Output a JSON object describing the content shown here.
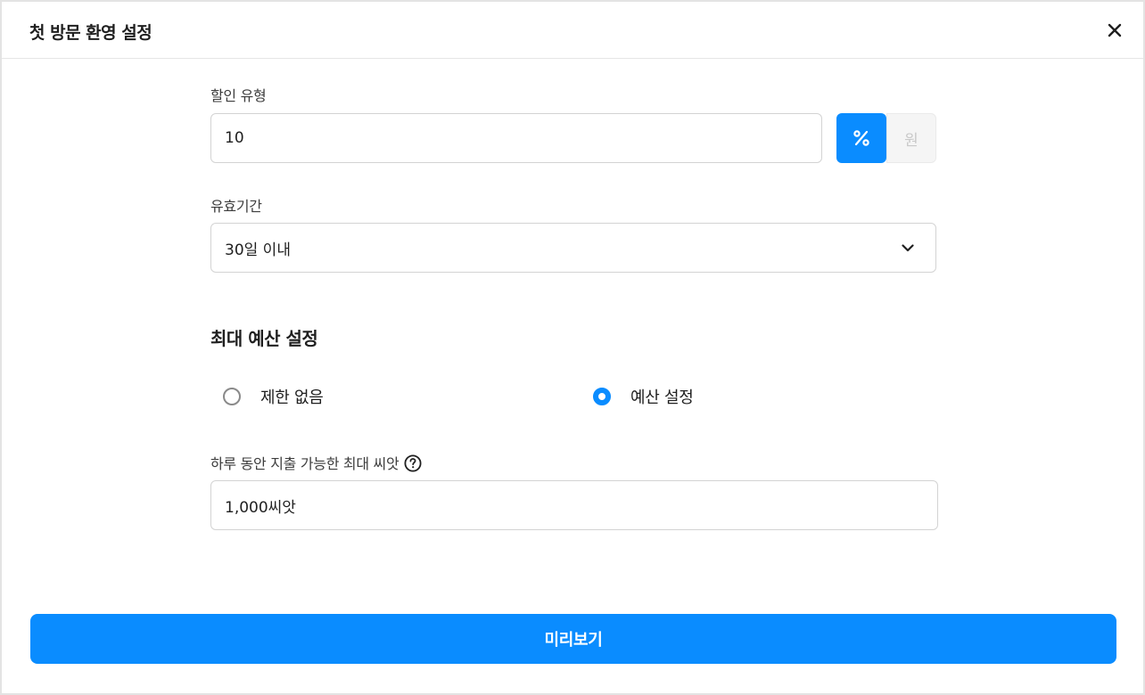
{
  "header": {
    "title": "첫 방문 환영 설정"
  },
  "discount": {
    "label": "할인 유형",
    "value": "10",
    "units": [
      "%",
      "원"
    ],
    "selected_unit": "%"
  },
  "validity": {
    "label": "유효기간",
    "selected": "30일 이내"
  },
  "budget": {
    "title": "최대 예산 설정",
    "options": [
      {
        "label": "제한 없음",
        "selected": false
      },
      {
        "label": "예산 설정",
        "selected": true
      }
    ],
    "daily_label": "하루 동안 지출 가능한 최대 씨앗",
    "daily_value": "1,000씨앗"
  },
  "footer": {
    "preview_label": "미리보기"
  },
  "colors": {
    "accent": "#0a8cff",
    "border": "#d3d3d3"
  },
  "icons": {
    "close": "close-icon",
    "dropdown": "chevron-down-icon",
    "help": "question-circle-icon",
    "percent": "percent-icon"
  }
}
